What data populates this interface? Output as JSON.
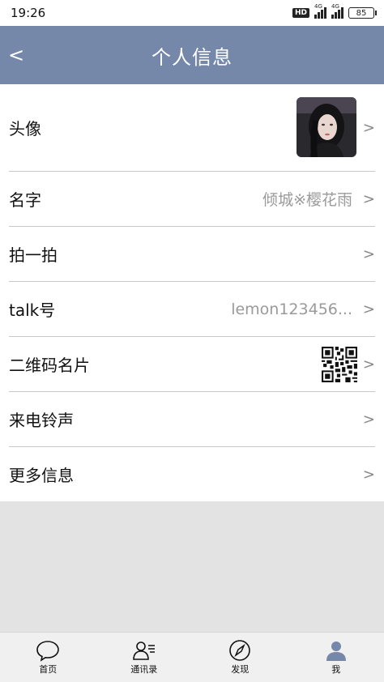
{
  "status_bar": {
    "time": "19:26",
    "hd_label": "HD",
    "network_1": "4G",
    "network_2": "4G",
    "battery": "85"
  },
  "header": {
    "back_label": "<",
    "title": "个人信息"
  },
  "rows": [
    {
      "label": "头像",
      "value": "",
      "chevron": ">"
    },
    {
      "label": "名字",
      "value": "倾城※樱花雨",
      "chevron": ">"
    },
    {
      "label": "拍一拍",
      "value": "",
      "chevron": ">"
    },
    {
      "label": "talk号",
      "value": "lemon123456...",
      "chevron": ">"
    },
    {
      "label": "二维码名片",
      "value": "",
      "chevron": ">"
    },
    {
      "label": "来电铃声",
      "value": "",
      "chevron": ">"
    },
    {
      "label": "更多信息",
      "value": "",
      "chevron": ">"
    }
  ],
  "bottom_nav": [
    {
      "label": "首页",
      "icon": "chat-bubble-icon"
    },
    {
      "label": "通讯录",
      "icon": "contacts-icon"
    },
    {
      "label": "发现",
      "icon": "compass-icon"
    },
    {
      "label": "我",
      "icon": "person-icon",
      "active": true
    }
  ],
  "colors": {
    "header_bg": "#7588aa",
    "active_nav": "#7588aa",
    "secondary_text": "#9a9a9a"
  }
}
